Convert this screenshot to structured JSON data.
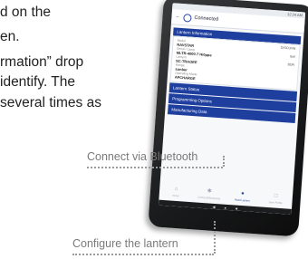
{
  "doc": {
    "lines": [
      "d on the",
      "en.",
      "rmation” drop",
      "identify. The",
      "several times as"
    ]
  },
  "callouts": {
    "connect": "Connect via Bluetooth",
    "configure": "Configure the lantern"
  },
  "tablet": {
    "status_time": "12:24 AM",
    "header_title": "Connected",
    "info_section": "Lantern Information",
    "info_rows": [
      {
        "label": "Model",
        "value": "NAVSTAR",
        "side": "DISCONN"
      },
      {
        "label": "Serial / Lamp",
        "value": "MLTR-4000-7 Hi0ppe",
        "side": "Sail"
      },
      {
        "label": "Lantern",
        "value": "SC-TRAOEE",
        "side": "BDR"
      },
      {
        "label": "Range",
        "value": "sunber",
        "side": ""
      },
      {
        "label": "Operating Mode",
        "value": "APCHARGE",
        "side": ""
      }
    ],
    "sections": [
      "Lantern Status",
      "Programming Options",
      "Manufacturing Data"
    ],
    "nav": [
      {
        "icon": "home-icon",
        "label": "Home"
      },
      {
        "icon": "bluetooth-icon",
        "label": "Connect/Disconnect"
      },
      {
        "icon": "lantern-icon",
        "label": "Read Lantern"
      },
      {
        "icon": "file-icon",
        "label": "Save Profile"
      }
    ],
    "active_nav_index": 2
  }
}
